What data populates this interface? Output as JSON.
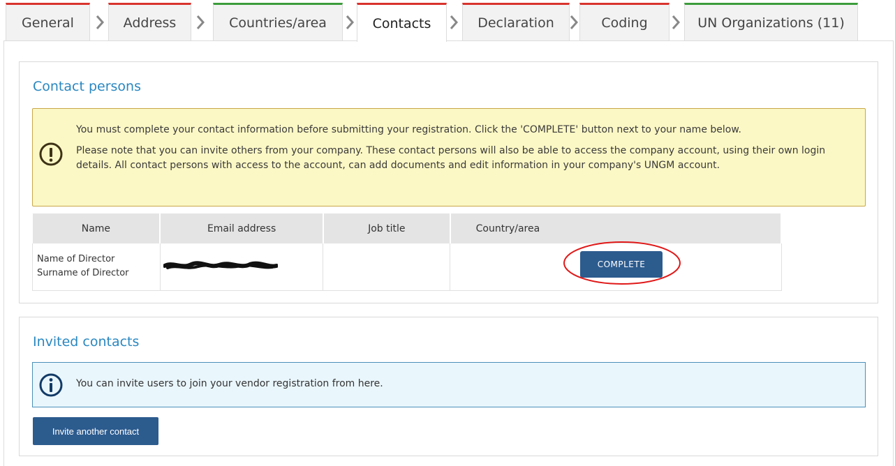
{
  "tabs": [
    {
      "label": "General",
      "status": "red"
    },
    {
      "label": "Address",
      "status": "red"
    },
    {
      "label": "Countries/area",
      "status": "green"
    },
    {
      "label": "Contacts",
      "status": "red",
      "active": true
    },
    {
      "label": "Declaration",
      "status": "red"
    },
    {
      "label": "Coding",
      "status": "red"
    },
    {
      "label": "UN Organizations (11)",
      "status": "green"
    }
  ],
  "contact_persons": {
    "title": "Contact persons",
    "warning": {
      "line1": "You must complete your contact information before submitting your registration. Click the 'COMPLETE' button next to your name below.",
      "line2": "Please note that you can invite others from your company. These contact persons will also be able to access the company account, using their own login details. All contact persons with access to the account, can add documents and edit information in your company's UNGM account."
    },
    "table": {
      "headers": [
        "Name",
        "Email address",
        "Job title",
        "Country/area"
      ],
      "rows": [
        {
          "name_line1": "Name of Director",
          "name_line2": "Surname of Director",
          "email": "",
          "job_title": "",
          "country": ""
        }
      ],
      "complete_label": "COMPLETE"
    }
  },
  "invited_contacts": {
    "title": "Invited contacts",
    "info": "You can invite users to join your vendor registration from here.",
    "invite_label": "Invite another contact"
  },
  "colors": {
    "accent_blue": "#2a87c0",
    "button_blue": "#2c5b8e",
    "status_red": "#d9322c",
    "status_green": "#3b9c3b",
    "warning_bg": "#fcf8c5",
    "info_bg": "#e9f6fc"
  }
}
